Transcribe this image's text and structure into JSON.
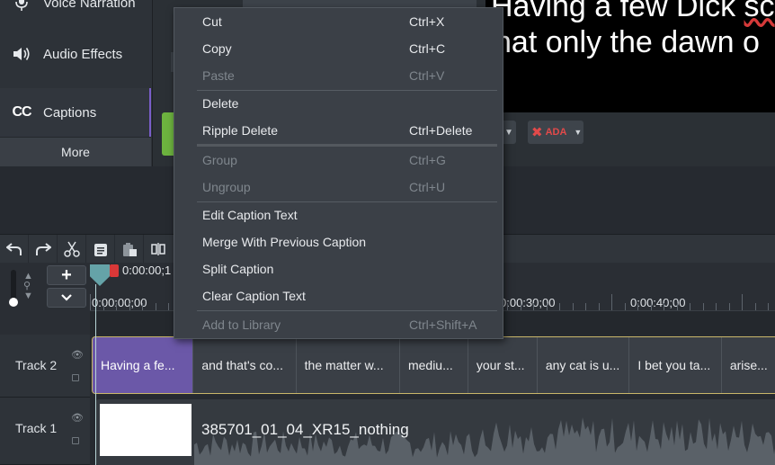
{
  "tools": {
    "voice_narration": "Voice Narration",
    "audio_effects": "Audio Effects",
    "captions": "Captions",
    "captions_icon": "CC",
    "more": "More"
  },
  "preview": {
    "line1_prefix": "Having a few Dick ",
    "line1_misspelled": "sc",
    "line2": "hat only the dawn o"
  },
  "props": {
    "ada_label": "ADA",
    "ada_status_color": "#e24a4a"
  },
  "context_menu": {
    "items": [
      {
        "label": "Cut",
        "shortcut": "Ctrl+X",
        "enabled": true
      },
      {
        "label": "Copy",
        "shortcut": "Ctrl+C",
        "enabled": true
      },
      {
        "label": "Paste",
        "shortcut": "Ctrl+V",
        "enabled": false
      },
      {
        "label": "Delete",
        "shortcut": "",
        "enabled": true
      },
      {
        "label": "Ripple Delete",
        "shortcut": "Ctrl+Delete",
        "enabled": true
      },
      {
        "label": "Group",
        "shortcut": "Ctrl+G",
        "enabled": false
      },
      {
        "label": "Ungroup",
        "shortcut": "Ctrl+U",
        "enabled": false
      },
      {
        "label": "Edit Caption Text",
        "shortcut": "",
        "enabled": true
      },
      {
        "label": "Merge With Previous Caption",
        "shortcut": "",
        "enabled": true
      },
      {
        "label": "Split Caption",
        "shortcut": "",
        "enabled": true
      },
      {
        "label": "Clear Caption Text",
        "shortcut": "",
        "enabled": true
      },
      {
        "label": "Add to Library",
        "shortcut": "Ctrl+Shift+A",
        "enabled": false
      }
    ]
  },
  "timeline": {
    "playhead_time": "0:00:00;1",
    "ruler_labels": [
      "0:00:00;00",
      "0:00:30;00",
      "0:00:40;00"
    ],
    "tracks": [
      {
        "name": "Track 2",
        "captions": [
          {
            "text": "Having a fe...",
            "selected": true
          },
          {
            "text": "and that's co...",
            "selected": false
          },
          {
            "text": "the matter w...",
            "selected": false
          },
          {
            "text": "mediu...",
            "selected": false
          },
          {
            "text": "your st...",
            "selected": false
          },
          {
            "text": "any cat is u...",
            "selected": false
          },
          {
            "text": "I bet you ta...",
            "selected": false
          },
          {
            "text": "arise...",
            "selected": false
          }
        ]
      },
      {
        "name": "Track 1",
        "media_title": "385701_01_04_XR15_nothing"
      }
    ]
  },
  "colors": {
    "caption_selected": "#6b58a8",
    "caption_track_border": "#c9b66a",
    "playhead": "#65a3a8",
    "playhead_marker": "#d93838",
    "captions_tool_accent": "#7a5ec9"
  }
}
